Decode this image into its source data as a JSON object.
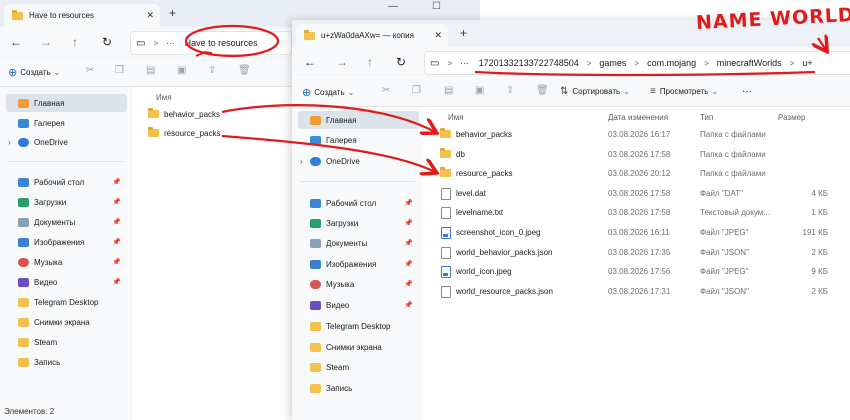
{
  "w1": {
    "tab_title": "Have to resources",
    "address": {
      "more": "···",
      "crumb": "Have to resources",
      "chev": ">"
    },
    "cmd": {
      "create": "Создать"
    },
    "sidebar": {
      "main": "Главная",
      "gallery": "Галерея",
      "onedrive": "OneDrive",
      "desktop": "Рабочий стол",
      "downloads": "Загрузки",
      "documents": "Документы",
      "images": "Изображения",
      "music": "Музыка",
      "video": "Видео",
      "telegram": "Telegram Desktop",
      "screenshots": "Снимки экрана",
      "steam": "Steam",
      "records": "Запись"
    },
    "header_name": "Имя",
    "items": [
      "behavior_packs",
      "resource_packs"
    ],
    "status": "Элементов: 2"
  },
  "w2": {
    "tab_title": "u+zWa0daAXw= — копия",
    "address": {
      "more": "···",
      "crumbs": [
        "17201332133722748504",
        "games",
        "com.mojang",
        "minecraftWorlds",
        "u+"
      ]
    },
    "cmd": {
      "create": "Создать",
      "sort": "Сортировать",
      "view": "Просмотреть",
      "more": "···"
    },
    "sidebar": {
      "main": "Главная",
      "gallery": "Галерея",
      "onedrive": "OneDrive",
      "desktop": "Рабочий стол",
      "downloads": "Загрузки",
      "documents": "Документы",
      "images": "Изображения",
      "music": "Музыка",
      "video": "Видео",
      "telegram": "Telegram Desktop",
      "screenshots": "Снимки экрана",
      "steam": "Steam",
      "records": "Запись"
    },
    "columns": {
      "name": "Имя",
      "date": "Дата изменения",
      "type": "Тип",
      "size": "Размер"
    },
    "files": [
      {
        "name": "behavior_packs",
        "date": "03.08.2026 16:17",
        "type": "Папка с файлами",
        "size": "",
        "icon": "folder"
      },
      {
        "name": "db",
        "date": "03.08.2026 17:58",
        "type": "Папка с файлами",
        "size": "",
        "icon": "folder"
      },
      {
        "name": "resource_packs",
        "date": "03.08.2026 20:12",
        "type": "Папка с файлами",
        "size": "",
        "icon": "folder"
      },
      {
        "name": "level.dat",
        "date": "03.08.2026 17:58",
        "type": "Файл \"DAT\"",
        "size": "4 КБ",
        "icon": "file"
      },
      {
        "name": "levelname.txt",
        "date": "03.08.2026 17:58",
        "type": "Текстовый докум...",
        "size": "1 КБ",
        "icon": "file"
      },
      {
        "name": "screenshot_icon_0.jpeg",
        "date": "03.08.2026 16:11",
        "type": "Файл \"JPEG\"",
        "size": "191 КБ",
        "icon": "image"
      },
      {
        "name": "world_behavior_packs.json",
        "date": "03.08.2026 17:35",
        "type": "Файл \"JSON\"",
        "size": "2 КБ",
        "icon": "file"
      },
      {
        "name": "world_icon.jpeg",
        "date": "03.08.2026 17:56",
        "type": "Файл \"JPEG\"",
        "size": "9 КБ",
        "icon": "image"
      },
      {
        "name": "world_resource_packs.json",
        "date": "03.08.2026 17:31",
        "type": "Файл \"JSON\"",
        "size": "2 КБ",
        "icon": "file"
      }
    ]
  },
  "annotation": {
    "text": "NAME WORLD",
    "color": "#e11b1b"
  }
}
